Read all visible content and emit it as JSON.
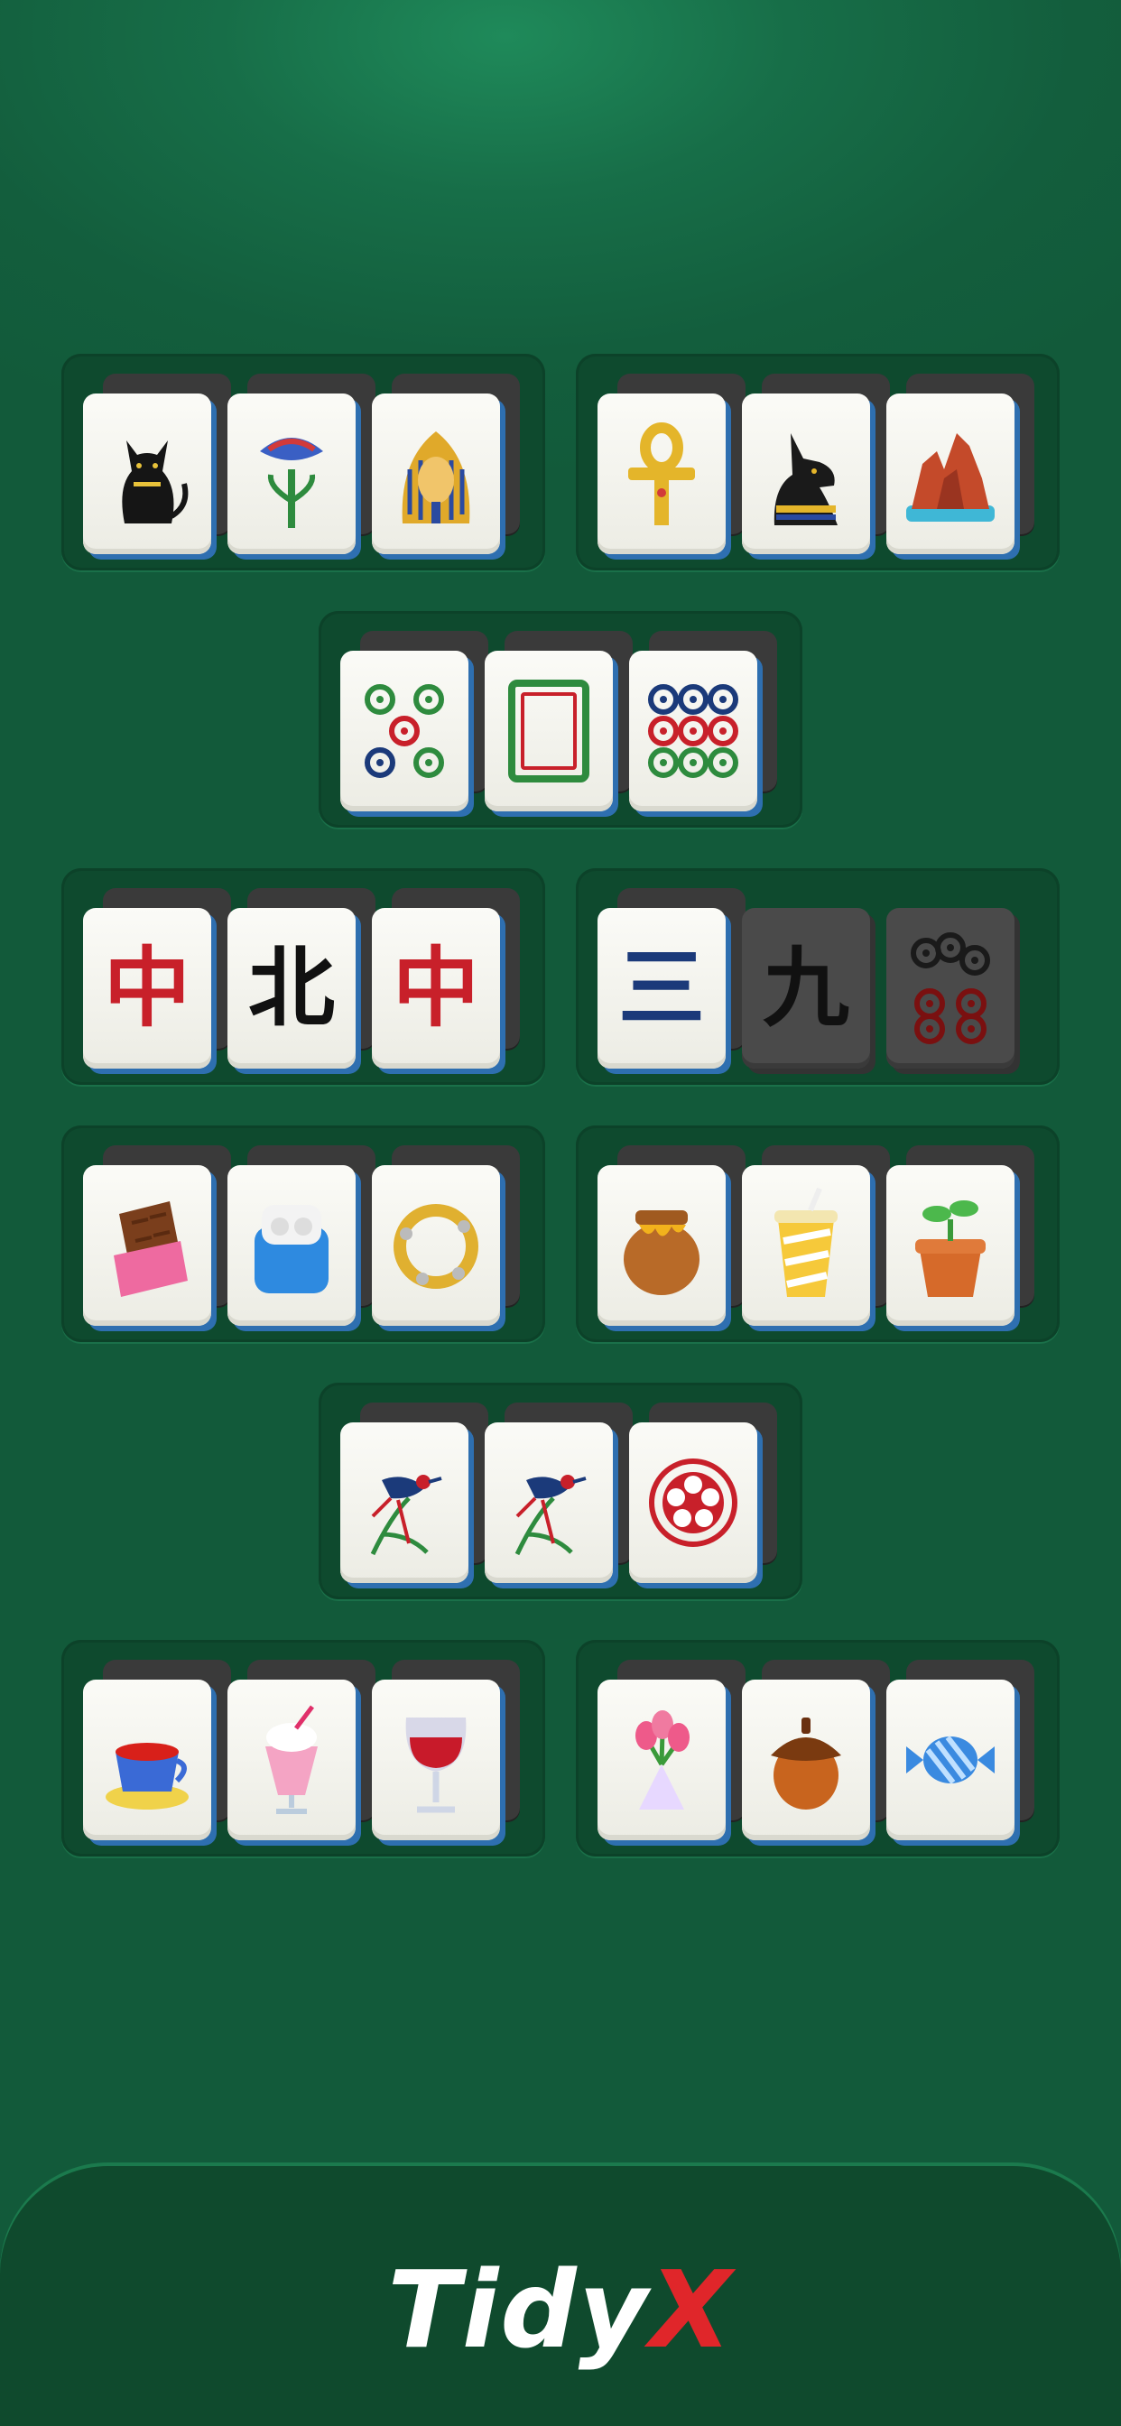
{
  "brand": {
    "name": "Tidy",
    "mark": "X",
    "colors": {
      "name": "#ffffff",
      "mark": "#e0262a"
    }
  },
  "colors": {
    "felt": "#125a3a",
    "tray": "#0e4a2e",
    "tile_face": "#f6f6f0",
    "tile_edge": "#2e6fb0",
    "tile_dark": "#4a4a4a"
  },
  "groups": [
    {
      "id": "egypt-set",
      "tiles": [
        {
          "icon": "black-cat-icon",
          "dark": false
        },
        {
          "icon": "papyrus-flower-icon",
          "dark": false
        },
        {
          "icon": "pharaoh-mask-icon",
          "dark": false
        }
      ]
    },
    {
      "id": "egypt-set-2",
      "tiles": [
        {
          "icon": "ankh-icon",
          "dark": false
        },
        {
          "icon": "anubis-icon",
          "dark": false
        },
        {
          "icon": "red-rock-canyon-icon",
          "dark": false
        }
      ]
    },
    {
      "id": "dots-set",
      "tiles": [
        {
          "icon": "five-dots-icon",
          "dark": false
        },
        {
          "icon": "white-dragon-icon",
          "dark": false
        },
        {
          "icon": "nine-dots-icon",
          "dark": false
        }
      ]
    },
    {
      "id": "characters-set",
      "tiles": [
        {
          "icon": "zhong-character-icon",
          "char": "中",
          "color": "#c8202a",
          "dark": false
        },
        {
          "icon": "bei-character-icon",
          "char": "北",
          "color": "#111111",
          "dark": false
        },
        {
          "icon": "zhong-character-icon",
          "char": "中",
          "color": "#c8202a",
          "dark": false
        }
      ]
    },
    {
      "id": "numbers-set",
      "tiles": [
        {
          "icon": "san-character-icon",
          "char": "三",
          "color": "#1b3a7a",
          "dark": false
        },
        {
          "icon": "jiu-character-icon",
          "char": "九",
          "color": "#111111",
          "dark": true
        },
        {
          "icon": "six-dots-icon",
          "dark": true
        }
      ]
    },
    {
      "id": "snacks-set",
      "tiles": [
        {
          "icon": "chocolate-bar-icon",
          "dark": false
        },
        {
          "icon": "earbuds-case-icon",
          "dark": false
        },
        {
          "icon": "tambourine-icon",
          "dark": false
        }
      ]
    },
    {
      "id": "home-set",
      "tiles": [
        {
          "icon": "honey-pot-icon",
          "dark": false
        },
        {
          "icon": "drink-cup-icon",
          "dark": false
        },
        {
          "icon": "sprout-pot-icon",
          "dark": false
        }
      ]
    },
    {
      "id": "birds-set",
      "tiles": [
        {
          "icon": "bird-bamboo-icon",
          "dark": false
        },
        {
          "icon": "bird-bamboo-icon",
          "dark": false
        },
        {
          "icon": "plum-blossom-icon",
          "dark": false
        }
      ]
    },
    {
      "id": "drinks-set",
      "tiles": [
        {
          "icon": "tea-cup-icon",
          "dark": false
        },
        {
          "icon": "milkshake-icon",
          "dark": false
        },
        {
          "icon": "wine-glass-icon",
          "dark": false
        }
      ]
    },
    {
      "id": "gifts-set",
      "tiles": [
        {
          "icon": "tulip-bouquet-icon",
          "dark": false
        },
        {
          "icon": "acorn-icon",
          "dark": false
        },
        {
          "icon": "candy-icon",
          "dark": false
        }
      ]
    }
  ]
}
